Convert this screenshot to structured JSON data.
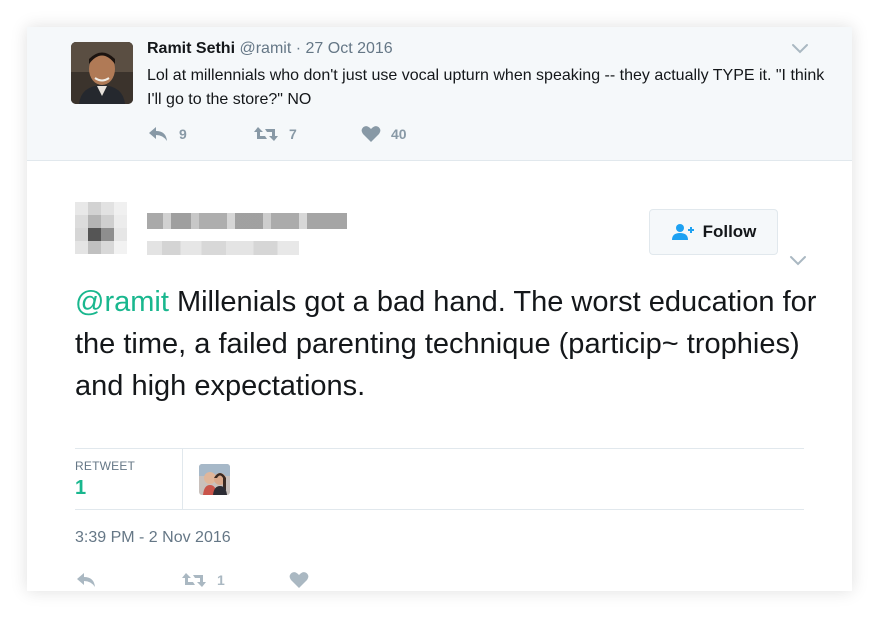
{
  "parent_tweet": {
    "author_name": "Ramit Sethi",
    "handle": "@ramit",
    "separator": "·",
    "date": "27 Oct 2016",
    "text": "Lol at millennials who don't just use vocal upturn when speaking -- they actually TYPE it. \"I think I'll go to the store?\" NO",
    "reply_count": "9",
    "retweet_count": "7",
    "like_count": "40"
  },
  "main_tweet": {
    "follow_label": "Follow",
    "mention": "@ramit",
    "text": " Millenials got a bad hand. The worst education for the time, a failed parenting technique (particip~ trophies) and high expectations.",
    "retweet_label": "RETWEET",
    "retweet_total": "1",
    "timestamp": "3:39 PM - 2 Nov 2016",
    "action_retweet_count": "1"
  },
  "colors": {
    "accent_green": "#19b78e",
    "icon_gray": "#8899a6",
    "parent_bg": "#f5f8fa"
  },
  "icons": [
    "chevron-down-icon",
    "reply-icon",
    "retweet-icon",
    "heart-icon",
    "follow-person-icon"
  ]
}
